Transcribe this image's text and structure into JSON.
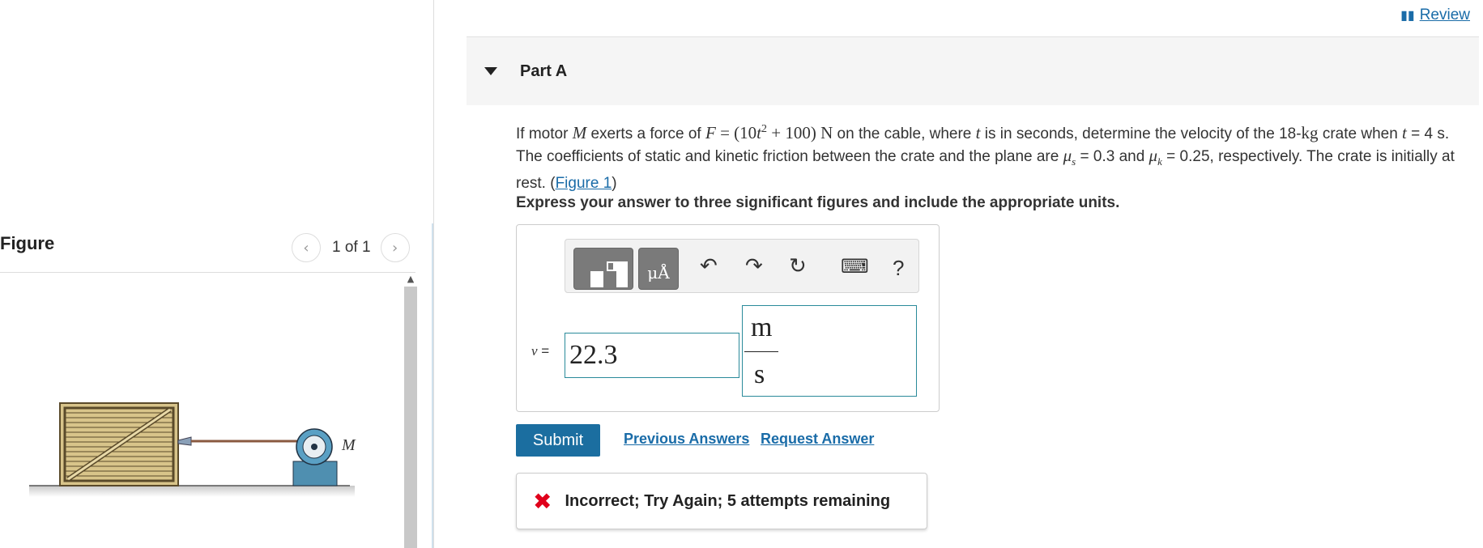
{
  "review": {
    "label": "Review",
    "icon": "book-icon"
  },
  "part": {
    "title": "Part A",
    "caret_icon": "caret-down-icon"
  },
  "question": {
    "before_motor": "If motor ",
    "motor_var": "M",
    "mid1": " exerts a force of ",
    "force_expr": "F = (10t",
    "force_exp": "2",
    "force_tail": " + 100) N",
    "mid2": " on the cable, where ",
    "t_var": "t",
    "mid3": " is in seconds, determine the velocity of the 18-",
    "kg": "kg",
    "mid4": " crate when ",
    "t_var2": "t",
    "mid5": " = 4 s. The coefficients of static and kinetic friction between the crate and the plane are ",
    "mu_s": "μ",
    "mu_s_sub": "s",
    "mid6": " = 0.3 and ",
    "mu_k": "μ",
    "mu_k_sub": "k",
    "mid7": " = 0.25, respectively. The crate is initially at rest. (",
    "figure_link": "Figure 1",
    "end": ")"
  },
  "instructions": "Express your answer to three significant figures and include the appropriate units.",
  "toolbar": {
    "templates_icon": "templates-icon",
    "units_label": "μÅ",
    "undo_icon": "undo-icon",
    "redo_icon": "redo-icon",
    "reset_icon": "reset-icon",
    "keyboard_icon": "keyboard-icon",
    "help_label": "?"
  },
  "answer": {
    "variable": "v",
    "equals": " =",
    "value": "22.3",
    "unit_numerator": "m",
    "unit_denominator": "s"
  },
  "actions": {
    "submit": "Submit",
    "previous": "Previous Answers",
    "request": "Request Answer"
  },
  "feedback": {
    "icon": "x-icon",
    "text": "Incorrect; Try Again; 5 attempts remaining",
    "color": "#e0001b"
  },
  "figure": {
    "title": "Figure",
    "pager_text": "1 of 1",
    "motor_label": "M"
  }
}
